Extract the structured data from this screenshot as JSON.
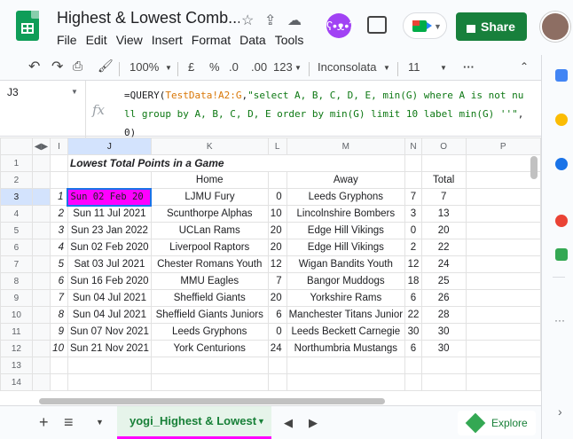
{
  "app": {
    "title": "Highest & Lowest Comb...",
    "menu": [
      "File",
      "Edit",
      "View",
      "Insert",
      "Format",
      "Data",
      "Tools"
    ],
    "share_label": "Share"
  },
  "toolbar": {
    "zoom": "100%",
    "currency": "£",
    "percent": "%",
    "dec_less": ".0",
    "dec_more": ".00",
    "format": "123",
    "font": "Inconsolata",
    "size": "11",
    "more": "···"
  },
  "formula_bar": {
    "cell_ref": "J3",
    "fx": "fx",
    "formula_parts": [
      "=QUERY(",
      "TestData!A2:G",
      ",",
      "\"select A, B, C, D, E, min(G) where A is not null group by A, B, C, D, E order by min(G) limit 10 label min(G) ''\"",
      ",0)"
    ]
  },
  "columns": [
    "I",
    "J",
    "K",
    "L",
    "M",
    "N",
    "O",
    "P"
  ],
  "rows": [
    {
      "n": "1",
      "i": "",
      "j": "Lowest Total Points in a Game",
      "k": "",
      "l": "",
      "m": "",
      "nn": "",
      "o": ""
    },
    {
      "n": "2",
      "i": "",
      "j": "",
      "k": "Home",
      "l": "",
      "m": "Away",
      "nn": "",
      "o": "Total"
    },
    {
      "n": "3",
      "i": "1",
      "j": "Sun 02 Feb 20",
      "k": "LJMU Fury",
      "l": "0",
      "m": "Leeds Gryphons",
      "nn": "7",
      "o": "7"
    },
    {
      "n": "4",
      "i": "2",
      "j": "Sun 11 Jul 2021",
      "k": "Scunthorpe Alphas",
      "l": "10",
      "m": "Lincolnshire Bombers",
      "nn": "3",
      "o": "13"
    },
    {
      "n": "5",
      "i": "3",
      "j": "Sun 23 Jan 2022",
      "k": "UCLan Rams",
      "l": "20",
      "m": "Edge Hill Vikings",
      "nn": "0",
      "o": "20"
    },
    {
      "n": "6",
      "i": "4",
      "j": "Sun 02 Feb 2020",
      "k": "Liverpool Raptors",
      "l": "20",
      "m": "Edge Hill Vikings",
      "nn": "2",
      "o": "22"
    },
    {
      "n": "7",
      "i": "5",
      "j": "Sat 03 Jul 2021",
      "k": "Chester Romans Youth",
      "l": "12",
      "m": "Wigan Bandits Youth",
      "nn": "12",
      "o": "24"
    },
    {
      "n": "8",
      "i": "6",
      "j": "Sun 16 Feb 2020",
      "k": "MMU Eagles",
      "l": "7",
      "m": "Bangor Muddogs",
      "nn": "18",
      "o": "25"
    },
    {
      "n": "9",
      "i": "7",
      "j": "Sun 04 Jul 2021",
      "k": "Sheffield Giants",
      "l": "20",
      "m": "Yorkshire Rams",
      "nn": "6",
      "o": "26"
    },
    {
      "n": "10",
      "i": "8",
      "j": "Sun 04 Jul 2021",
      "k": "Sheffield Giants Juniors",
      "l": "6",
      "m": "Manchester Titans Junior",
      "nn": "22",
      "o": "28"
    },
    {
      "n": "11",
      "i": "9",
      "j": "Sun 07 Nov 2021",
      "k": "Leeds Gryphons",
      "l": "0",
      "m": "Leeds Beckett Carnegie",
      "nn": "30",
      "o": "30"
    },
    {
      "n": "12",
      "i": "10",
      "j": "Sun 21 Nov 2021",
      "k": "York Centurions",
      "l": "24",
      "m": "Northumbria Mustangs",
      "nn": "6",
      "o": "30"
    },
    {
      "n": "13",
      "i": "",
      "j": "",
      "k": "",
      "l": "",
      "m": "",
      "nn": "",
      "o": ""
    },
    {
      "n": "14",
      "i": "",
      "j": "",
      "k": "",
      "l": "",
      "m": "",
      "nn": "",
      "o": ""
    }
  ],
  "sheet_tab": "yogi_Highest & Lowest",
  "explore_label": "Explore",
  "colors": {
    "selected_fill": "#ff00ff",
    "accent": "#188038"
  }
}
